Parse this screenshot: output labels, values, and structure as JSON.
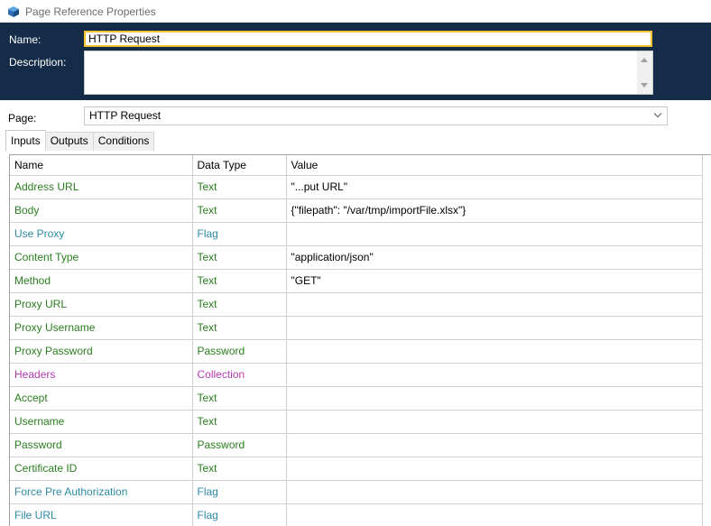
{
  "window": {
    "title": "Page Reference Properties"
  },
  "header": {
    "name_label": "Name:",
    "name_value": "HTTP Request",
    "description_label": "Description:",
    "description_value": ""
  },
  "page": {
    "label": "Page:",
    "selected": "HTTP Request"
  },
  "tabs": [
    {
      "label": "Inputs",
      "active": true
    },
    {
      "label": "Outputs",
      "active": false
    },
    {
      "label": "Conditions",
      "active": false
    }
  ],
  "grid": {
    "columns": [
      "Name",
      "Data Type",
      "Value"
    ],
    "rows": [
      {
        "name": "Address URL",
        "type": "Text",
        "value": "\"...put URL\""
      },
      {
        "name": "Body",
        "type": "Text",
        "value": "{\"filepath\": \"/var/tmp/importFile.xlsx\"}"
      },
      {
        "name": "Use Proxy",
        "type": "Flag",
        "value": ""
      },
      {
        "name": "Content Type",
        "type": "Text",
        "value": "\"application/json\""
      },
      {
        "name": "Method",
        "type": "Text",
        "value": "\"GET\""
      },
      {
        "name": "Proxy URL",
        "type": "Text",
        "value": ""
      },
      {
        "name": "Proxy Username",
        "type": "Text",
        "value": ""
      },
      {
        "name": "Proxy Password",
        "type": "Password",
        "value": ""
      },
      {
        "name": "Headers",
        "type": "Collection",
        "value": ""
      },
      {
        "name": "Accept",
        "type": "Text",
        "value": ""
      },
      {
        "name": "Username",
        "type": "Text",
        "value": ""
      },
      {
        "name": "Password",
        "type": "Password",
        "value": ""
      },
      {
        "name": "Certificate ID",
        "type": "Text",
        "value": ""
      },
      {
        "name": "Force Pre Authorization",
        "type": "Flag",
        "value": ""
      },
      {
        "name": "File URL",
        "type": "Flag",
        "value": ""
      }
    ]
  },
  "colors": {
    "header_bg": "#142c47",
    "text_type": "#2a7d1f",
    "flag_type": "#2e8aa3",
    "collection_type": "#b539b2",
    "focus_border": "#f2c230"
  },
  "icons": {
    "app": "page-reference-icon"
  }
}
